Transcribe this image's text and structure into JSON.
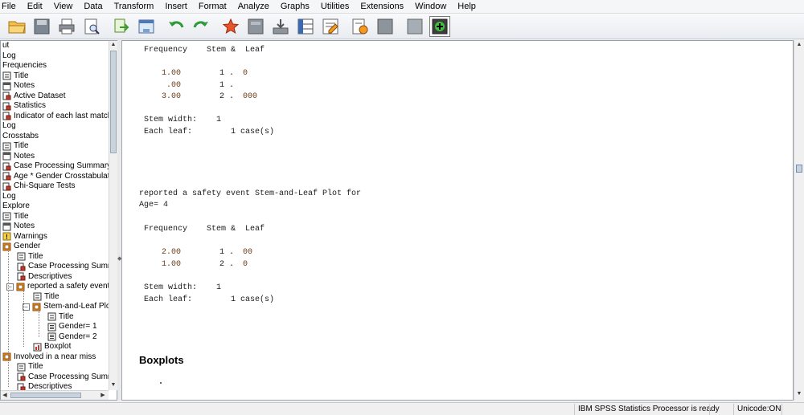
{
  "menu": [
    "File",
    "Edit",
    "View",
    "Data",
    "Transform",
    "Insert",
    "Format",
    "Analyze",
    "Graphs",
    "Utilities",
    "Extensions",
    "Window",
    "Help"
  ],
  "toolbar": {
    "icons": [
      "open-folder-icon",
      "save-icon",
      "print-icon",
      "print-preview-icon",
      "export-icon",
      "recall-dialog-icon",
      "undo-icon",
      "redo-icon",
      "goto-data-icon",
      "goto-case-icon",
      "goto-variable-icon",
      "variables-icon",
      "designate-window-icon",
      "create-title-icon",
      "insert-heading-icon",
      "show-all-icon",
      "add-output-icon"
    ]
  },
  "tree": {
    "items": [
      {
        "label": "ut",
        "depth": 0,
        "icon": "none"
      },
      {
        "label": "Log",
        "depth": 0,
        "icon": "none"
      },
      {
        "label": "Frequencies",
        "depth": 0,
        "icon": "none"
      },
      {
        "label": "Title",
        "depth": 0,
        "icon": "title-icon"
      },
      {
        "label": "Notes",
        "depth": 0,
        "icon": "notes-icon"
      },
      {
        "label": "Active Dataset",
        "depth": 0,
        "icon": "table-icon"
      },
      {
        "label": "Statistics",
        "depth": 0,
        "icon": "table-icon"
      },
      {
        "label": "Indicator of each last matching",
        "depth": 0,
        "icon": "table-icon"
      },
      {
        "label": "Log",
        "depth": 0,
        "icon": "none"
      },
      {
        "label": "Crosstabs",
        "depth": 0,
        "icon": "none"
      },
      {
        "label": "Title",
        "depth": 0,
        "icon": "title-icon"
      },
      {
        "label": "Notes",
        "depth": 0,
        "icon": "notes-icon"
      },
      {
        "label": "Case Processing Summary",
        "depth": 0,
        "icon": "table-icon"
      },
      {
        "label": "Age * Gender Crosstabulation",
        "depth": 0,
        "icon": "table-icon"
      },
      {
        "label": "Chi-Square Tests",
        "depth": 0,
        "icon": "table-icon"
      },
      {
        "label": "Log",
        "depth": 0,
        "icon": "none"
      },
      {
        "label": "Explore",
        "depth": 0,
        "icon": "none"
      },
      {
        "label": "Title",
        "depth": 0,
        "icon": "title-icon"
      },
      {
        "label": "Notes",
        "depth": 0,
        "icon": "notes-icon"
      },
      {
        "label": "Warnings",
        "depth": 0,
        "icon": "warning-icon"
      },
      {
        "label": "Gender",
        "depth": 0,
        "icon": "book-icon"
      },
      {
        "label": "Title",
        "depth": 1,
        "icon": "title-icon"
      },
      {
        "label": "Case Processing Summary",
        "depth": 1,
        "icon": "table-icon"
      },
      {
        "label": "Descriptives",
        "depth": 1,
        "icon": "table-icon"
      },
      {
        "label": "reported a safety event",
        "depth": 1,
        "icon": "book-icon",
        "toggle": "−"
      },
      {
        "label": "Title",
        "depth": 2,
        "icon": "title-icon"
      },
      {
        "label": "Stem-and-Leaf Plots",
        "depth": 2,
        "icon": "book-icon",
        "toggle": "−"
      },
      {
        "label": "Title",
        "depth": 3,
        "icon": "title-icon"
      },
      {
        "label": "Gender= 1",
        "depth": 3,
        "icon": "text-icon"
      },
      {
        "label": "Gender= 2",
        "depth": 3,
        "icon": "text-icon"
      },
      {
        "label": "Boxplot",
        "depth": 2,
        "icon": "chart-icon"
      },
      {
        "label": "Involved in a near miss",
        "depth": 0,
        "icon": "book-icon"
      },
      {
        "label": "Title",
        "depth": 1,
        "icon": "title-icon"
      },
      {
        "label": "Case Processing Summary",
        "depth": 1,
        "icon": "table-icon"
      },
      {
        "label": "Descriptives",
        "depth": 1,
        "icon": "table-icon"
      }
    ]
  },
  "output": {
    "block1": {
      "header": "Frequency    Stem &  Leaf",
      "rows": [
        {
          "freq": "1.00",
          "stem": "1 .",
          "leaf": "0"
        },
        {
          "freq": " .00",
          "stem": "1 .",
          "leaf": ""
        },
        {
          "freq": "3.00",
          "stem": "2 .",
          "leaf": "000"
        }
      ],
      "stem_width": "Stem width:    1",
      "each_leaf": "Each leaf:        1 case(s)"
    },
    "plot_title_line1": "reported a safety event Stem-and-Leaf Plot for",
    "plot_title_line2": "Age= 4",
    "block2": {
      "header": "Frequency    Stem &  Leaf",
      "rows": [
        {
          "freq": "2.00",
          "stem": "1 .",
          "leaf": "00"
        },
        {
          "freq": "1.00",
          "stem": "2 .",
          "leaf": "0"
        }
      ],
      "stem_width": "Stem width:    1",
      "each_leaf": "Each leaf:        1 case(s)"
    },
    "boxplots_heading": "Boxplots"
  },
  "status": {
    "processor": "IBM SPSS Statistics Processor is ready",
    "unicode": "Unicode:ON"
  },
  "colors": {
    "accent": "#f59a1c",
    "number_text": "#6b3a17",
    "selection_border": "#6d8db5"
  }
}
